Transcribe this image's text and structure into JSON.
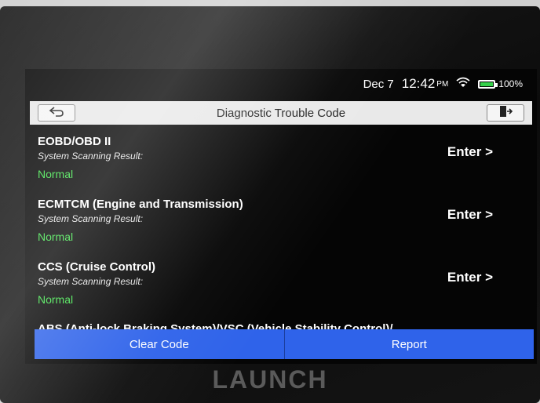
{
  "status_bar": {
    "date": "Dec 7",
    "time": "12:42",
    "ampm": "PM",
    "battery": "100%"
  },
  "header": {
    "title": "Diagnostic Trouble Code",
    "back_icon": "back-arrow-icon",
    "exit_icon": "exit-door-icon"
  },
  "systems": [
    {
      "name": "EOBD/OBD II",
      "subtitle": "System Scanning Result:",
      "status": "Normal",
      "action": "Enter >"
    },
    {
      "name": "ECMTCM (Engine and Transmission)",
      "subtitle": "System Scanning Result:",
      "status": "Normal",
      "action": "Enter >"
    },
    {
      "name": "CCS (Cruise Control)",
      "subtitle": "System Scanning Result:",
      "status": "Normal",
      "action": "Enter >"
    }
  ],
  "partial_item": "ABS (Anti-lock Braking System)/VSC (Vehicle Stability Control)/",
  "footer": {
    "clear_code": "Clear Code",
    "report": "Report"
  },
  "brand": "LAUNCH",
  "colors": {
    "normal_status": "#3fe34a",
    "action_bar": "#2f63ea",
    "battery": "#35d14a"
  }
}
